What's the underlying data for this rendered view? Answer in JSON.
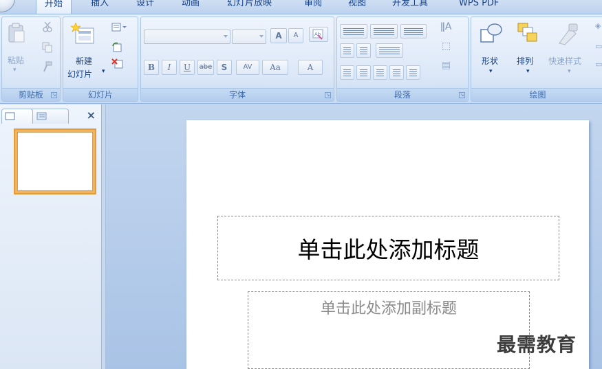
{
  "tabs": [
    "开始",
    "插入",
    "设计",
    "动画",
    "幻灯片放映",
    "审阅",
    "视图",
    "开发工具",
    "WPS PDF"
  ],
  "clipboard": {
    "group_label": "剪贴板",
    "paste_label": "粘贴"
  },
  "slides_group": {
    "group_label": "幻灯片",
    "new_slide_line1": "新建",
    "new_slide_line2": "幻灯片"
  },
  "font_group": {
    "group_label": "字体",
    "grow_label": "A",
    "shrink_label": "A",
    "bold_label": "B",
    "italic_label": "I",
    "underline_label": "U",
    "strike_label": "abe",
    "shadow_label": "S",
    "spacing_label": "AV",
    "case_label": "Aa",
    "color_label": "A"
  },
  "paragraph_group": {
    "group_label": "段落"
  },
  "drawing_group": {
    "group_label": "绘图",
    "shapes_label": "形状",
    "arrange_label": "排列",
    "quick_styles_label": "快速样式"
  },
  "slide": {
    "title_placeholder": "单击此处添加标题",
    "subtitle_placeholder": "单击此处添加副标题"
  },
  "watermark": "最需教育",
  "colors": {
    "ribbon_blue": "#dbe7f7",
    "accent_orange": "#f2b35e",
    "text_blue": "#15428b"
  }
}
